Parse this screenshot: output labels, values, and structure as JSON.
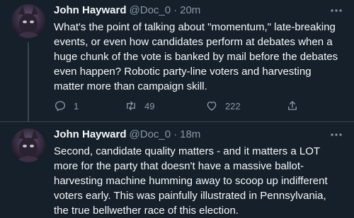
{
  "tweets": [
    {
      "name": "John Hayward",
      "handle": "@Doc_0",
      "separator": "·",
      "time": "20m",
      "text": "What's the point of talking about \"momentum,\" late-breaking\nevents, or even how candidates perform at debates when a\nhuge chunk of the vote is banked by mail before the debates\neven happen? Robotic party-line voters and harvesting\nmatter more than campaign skill.",
      "reply_count": "1",
      "retweet_count": "49",
      "like_count": "222"
    },
    {
      "name": "John Hayward",
      "handle": "@Doc_0",
      "separator": "·",
      "time": "18m",
      "text": "Second, candidate quality matters - and it matters a LOT\nmore for the party that doesn't have a massive ballot-\nharvesting machine humming away to scoop up indifferent\nvoters early. This was painfully illustrated in Pennsylvania,\nthe true bellwether race of this election."
    }
  ],
  "colors": {
    "background": "#15202b",
    "text": "#f7f9f9",
    "muted": "#8b98a5",
    "divider": "#38444d"
  },
  "icons": [
    "more-icon",
    "reply-icon",
    "retweet-icon",
    "like-icon",
    "share-icon"
  ]
}
